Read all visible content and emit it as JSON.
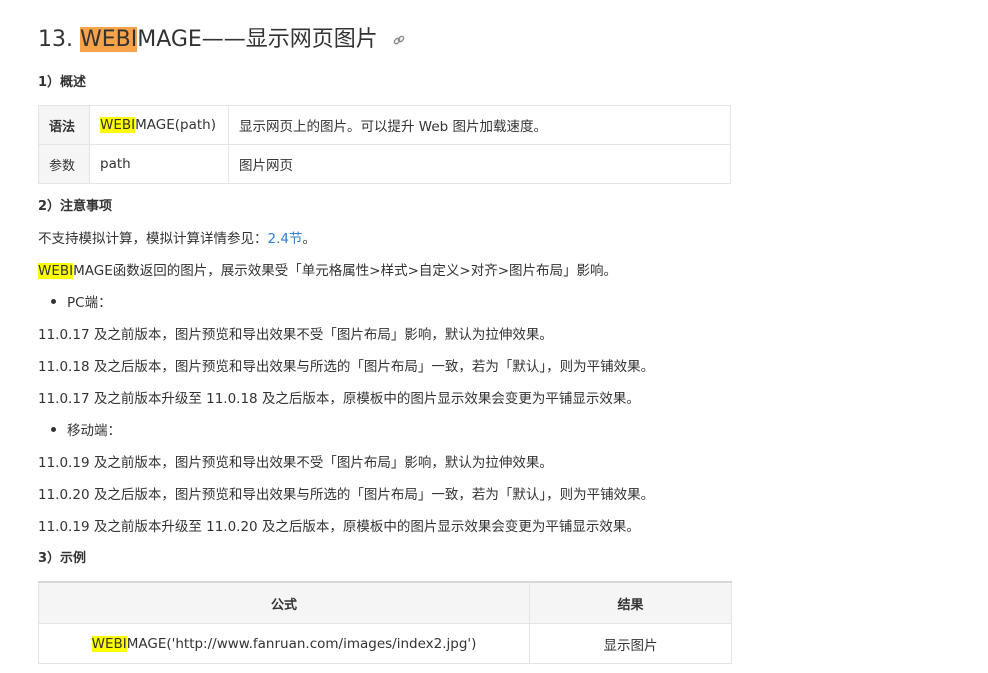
{
  "heading": {
    "number": "13. ",
    "highlight": "WEBI",
    "rest": "MAGE——显示网页图片"
  },
  "section1": "1）概述",
  "syntax_table": {
    "row1": {
      "key": "语法",
      "hl": "WEBI",
      "code_rest": "MAGE(path)",
      "desc": "显示网页上的图片。可以提升 Web 图片加载速度。"
    },
    "row2": {
      "key": "参数",
      "code": "path",
      "desc": "图片网页"
    }
  },
  "section2": "2）注意事项",
  "note1": {
    "text": "不支持模拟计算，模拟计算详情参见：",
    "link": "2.4节",
    "end": "。"
  },
  "note2": {
    "hl": "WEBI",
    "rest": "MAGE函数返回的图片，展示效果受「单元格属性>样式>自定义>对齐>图片布局」影响。"
  },
  "pc": {
    "label": "PC端：",
    "lines": [
      "11.0.17 及之前版本，图片预览和导出效果不受「图片布局」影响，默认为拉伸效果。",
      "11.0.18 及之后版本，图片预览和导出效果与所选的「图片布局」一致，若为「默认」，则为平铺效果。",
      "11.0.17 及之前版本升级至 11.0.18 及之后版本，原模板中的图片显示效果会变更为平铺显示效果。"
    ]
  },
  "mobile": {
    "label": "移动端：",
    "lines": [
      "11.0.19 及之前版本，图片预览和导出效果不受「图片布局」影响，默认为拉伸效果。",
      "11.0.20 及之后版本，图片预览和导出效果与所选的「图片布局」一致，若为「默认」，则为平铺效果。",
      "11.0.19 及之前版本升级至 11.0.20 及之后版本，原模板中的图片显示效果会变更为平铺显示效果。"
    ]
  },
  "section3": "3）示例",
  "example_table": {
    "header_formula": "公式",
    "header_result": "结果",
    "hl": "WEBI",
    "formula_rest": "MAGE('http://www.fanruan.com/images/index2.jpg')",
    "result": "显示图片"
  },
  "colors": {
    "highlight": "#ffff00",
    "title_highlight": "#f7a34a",
    "link": "#2f7fd1"
  }
}
